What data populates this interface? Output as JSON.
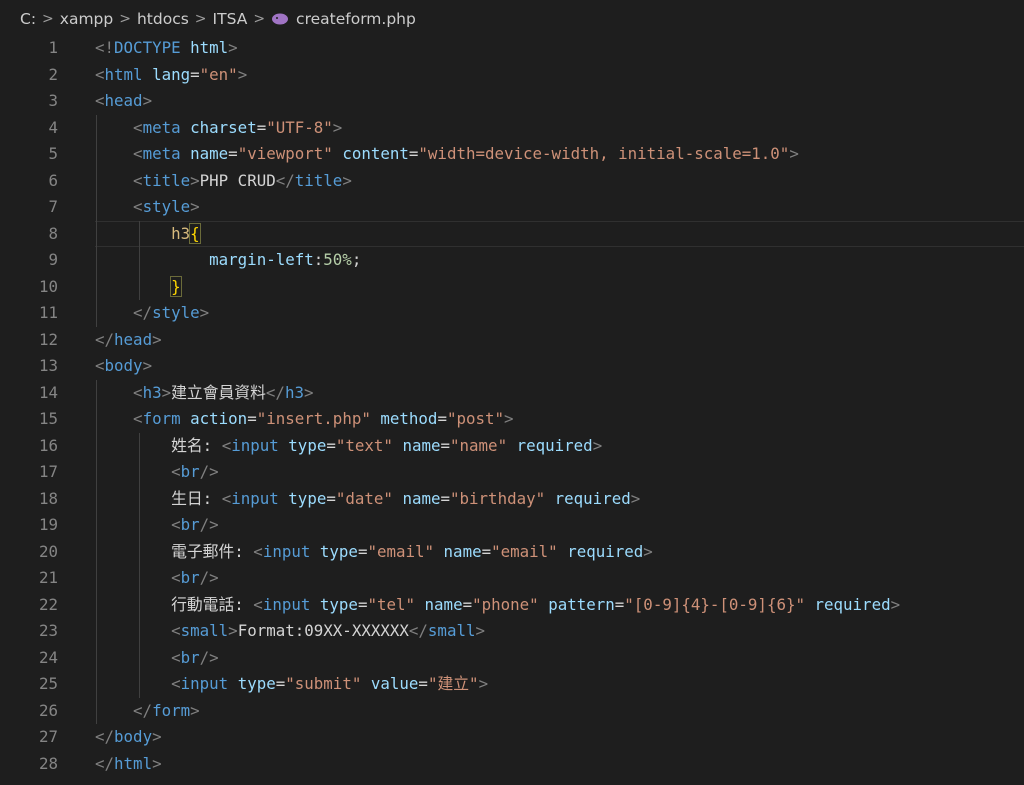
{
  "breadcrumb": {
    "items": [
      "C:",
      "xampp",
      "htdocs",
      "ITSA",
      "createform.php"
    ],
    "separator": ">",
    "file_icon": "php-elephant-icon"
  },
  "editor": {
    "line_numbers": [
      "1",
      "2",
      "3",
      "4",
      "5",
      "6",
      "7",
      "8",
      "9",
      "10",
      "11",
      "12",
      "13",
      "14",
      "15",
      "16",
      "17",
      "18",
      "19",
      "20",
      "21",
      "22",
      "23",
      "24",
      "25",
      "26",
      "27",
      "28"
    ],
    "lines": [
      [
        [
          "t",
          "<!"
        ],
        [
          "tag",
          "DOCTYPE"
        ],
        [
          "tx",
          " "
        ],
        [
          "at",
          "html"
        ],
        [
          "t",
          ">"
        ]
      ],
      [
        [
          "t",
          "<"
        ],
        [
          "tag",
          "html"
        ],
        [
          "tx",
          " "
        ],
        [
          "at",
          "lang"
        ],
        [
          "tx",
          "="
        ],
        [
          "st",
          "\"en\""
        ],
        [
          "t",
          ">"
        ]
      ],
      [
        [
          "t",
          "<"
        ],
        [
          "tag",
          "head"
        ],
        [
          "t",
          ">"
        ]
      ],
      [
        [
          "tx",
          "    "
        ],
        [
          "t",
          "<"
        ],
        [
          "tag",
          "meta"
        ],
        [
          "tx",
          " "
        ],
        [
          "at",
          "charset"
        ],
        [
          "tx",
          "="
        ],
        [
          "st",
          "\"UTF-8\""
        ],
        [
          "t",
          ">"
        ]
      ],
      [
        [
          "tx",
          "    "
        ],
        [
          "t",
          "<"
        ],
        [
          "tag",
          "meta"
        ],
        [
          "tx",
          " "
        ],
        [
          "at",
          "name"
        ],
        [
          "tx",
          "="
        ],
        [
          "st",
          "\"viewport\""
        ],
        [
          "tx",
          " "
        ],
        [
          "at",
          "content"
        ],
        [
          "tx",
          "="
        ],
        [
          "st",
          "\"width=device-width, initial-scale=1.0\""
        ],
        [
          "t",
          ">"
        ]
      ],
      [
        [
          "tx",
          "    "
        ],
        [
          "t",
          "<"
        ],
        [
          "tag",
          "title"
        ],
        [
          "t",
          ">"
        ],
        [
          "tx",
          "PHP CRUD"
        ],
        [
          "t",
          "</"
        ],
        [
          "tag",
          "title"
        ],
        [
          "t",
          ">"
        ]
      ],
      [
        [
          "tx",
          "    "
        ],
        [
          "t",
          "<"
        ],
        [
          "tag",
          "style"
        ],
        [
          "t",
          ">"
        ]
      ],
      [
        [
          "tx",
          "        "
        ],
        [
          "sel",
          "h3"
        ],
        [
          "brace",
          "{"
        ]
      ],
      [
        [
          "tx",
          "            "
        ],
        [
          "at",
          "margin-left"
        ],
        [
          "tx",
          ":"
        ],
        [
          "num",
          "50%"
        ],
        [
          "tx",
          ";"
        ]
      ],
      [
        [
          "tx",
          "        "
        ],
        [
          "brace",
          "}"
        ]
      ],
      [
        [
          "tx",
          "    "
        ],
        [
          "t",
          "</"
        ],
        [
          "tag",
          "style"
        ],
        [
          "t",
          ">"
        ]
      ],
      [
        [
          "t",
          "</"
        ],
        [
          "tag",
          "head"
        ],
        [
          "t",
          ">"
        ]
      ],
      [
        [
          "t",
          "<"
        ],
        [
          "tag",
          "body"
        ],
        [
          "t",
          ">"
        ]
      ],
      [
        [
          "tx",
          "    "
        ],
        [
          "t",
          "<"
        ],
        [
          "tag",
          "h3"
        ],
        [
          "t",
          ">"
        ],
        [
          "tx",
          "建立會員資料"
        ],
        [
          "t",
          "</"
        ],
        [
          "tag",
          "h3"
        ],
        [
          "t",
          ">"
        ]
      ],
      [
        [
          "tx",
          "    "
        ],
        [
          "t",
          "<"
        ],
        [
          "tag",
          "form"
        ],
        [
          "tx",
          " "
        ],
        [
          "at",
          "action"
        ],
        [
          "tx",
          "="
        ],
        [
          "st",
          "\"insert.php\""
        ],
        [
          "tx",
          " "
        ],
        [
          "at",
          "method"
        ],
        [
          "tx",
          "="
        ],
        [
          "st",
          "\"post\""
        ],
        [
          "t",
          ">"
        ]
      ],
      [
        [
          "tx",
          "        姓名: "
        ],
        [
          "t",
          "<"
        ],
        [
          "tag",
          "input"
        ],
        [
          "tx",
          " "
        ],
        [
          "at",
          "type"
        ],
        [
          "tx",
          "="
        ],
        [
          "st",
          "\"text\""
        ],
        [
          "tx",
          " "
        ],
        [
          "at",
          "name"
        ],
        [
          "tx",
          "="
        ],
        [
          "st",
          "\"name\""
        ],
        [
          "tx",
          " "
        ],
        [
          "at",
          "required"
        ],
        [
          "t",
          ">"
        ]
      ],
      [
        [
          "tx",
          "        "
        ],
        [
          "t",
          "<"
        ],
        [
          "tag",
          "br"
        ],
        [
          "t",
          "/>"
        ]
      ],
      [
        [
          "tx",
          "        生日: "
        ],
        [
          "t",
          "<"
        ],
        [
          "tag",
          "input"
        ],
        [
          "tx",
          " "
        ],
        [
          "at",
          "type"
        ],
        [
          "tx",
          "="
        ],
        [
          "st",
          "\"date\""
        ],
        [
          "tx",
          " "
        ],
        [
          "at",
          "name"
        ],
        [
          "tx",
          "="
        ],
        [
          "st",
          "\"birthday\""
        ],
        [
          "tx",
          " "
        ],
        [
          "at",
          "required"
        ],
        [
          "t",
          ">"
        ]
      ],
      [
        [
          "tx",
          "        "
        ],
        [
          "t",
          "<"
        ],
        [
          "tag",
          "br"
        ],
        [
          "t",
          "/>"
        ]
      ],
      [
        [
          "tx",
          "        電子郵件: "
        ],
        [
          "t",
          "<"
        ],
        [
          "tag",
          "input"
        ],
        [
          "tx",
          " "
        ],
        [
          "at",
          "type"
        ],
        [
          "tx",
          "="
        ],
        [
          "st",
          "\"email\""
        ],
        [
          "tx",
          " "
        ],
        [
          "at",
          "name"
        ],
        [
          "tx",
          "="
        ],
        [
          "st",
          "\"email\""
        ],
        [
          "tx",
          " "
        ],
        [
          "at",
          "required"
        ],
        [
          "t",
          ">"
        ]
      ],
      [
        [
          "tx",
          "        "
        ],
        [
          "t",
          "<"
        ],
        [
          "tag",
          "br"
        ],
        [
          "t",
          "/>"
        ]
      ],
      [
        [
          "tx",
          "        行動電話: "
        ],
        [
          "t",
          "<"
        ],
        [
          "tag",
          "input"
        ],
        [
          "tx",
          " "
        ],
        [
          "at",
          "type"
        ],
        [
          "tx",
          "="
        ],
        [
          "st",
          "\"tel\""
        ],
        [
          "tx",
          " "
        ],
        [
          "at",
          "name"
        ],
        [
          "tx",
          "="
        ],
        [
          "st",
          "\"phone\""
        ],
        [
          "tx",
          " "
        ],
        [
          "at",
          "pattern"
        ],
        [
          "tx",
          "="
        ],
        [
          "st",
          "\"[0-9]{4}-[0-9]{6}\""
        ],
        [
          "tx",
          " "
        ],
        [
          "at",
          "required"
        ],
        [
          "t",
          ">"
        ]
      ],
      [
        [
          "tx",
          "        "
        ],
        [
          "t",
          "<"
        ],
        [
          "tag",
          "small"
        ],
        [
          "t",
          ">"
        ],
        [
          "tx",
          "Format:09XX-XXXXXX"
        ],
        [
          "t",
          "</"
        ],
        [
          "tag",
          "small"
        ],
        [
          "t",
          ">"
        ]
      ],
      [
        [
          "tx",
          "        "
        ],
        [
          "t",
          "<"
        ],
        [
          "tag",
          "br"
        ],
        [
          "t",
          "/>"
        ]
      ],
      [
        [
          "tx",
          "        "
        ],
        [
          "t",
          "<"
        ],
        [
          "tag",
          "input"
        ],
        [
          "tx",
          " "
        ],
        [
          "at",
          "type"
        ],
        [
          "tx",
          "="
        ],
        [
          "st",
          "\"submit\""
        ],
        [
          "tx",
          " "
        ],
        [
          "at",
          "value"
        ],
        [
          "tx",
          "="
        ],
        [
          "st",
          "\"建立\""
        ],
        [
          "t",
          ">"
        ]
      ],
      [
        [
          "tx",
          "    "
        ],
        [
          "t",
          "</"
        ],
        [
          "tag",
          "form"
        ],
        [
          "t",
          ">"
        ]
      ],
      [
        [
          "t",
          "</"
        ],
        [
          "tag",
          "body"
        ],
        [
          "t",
          ">"
        ]
      ],
      [
        [
          "t",
          "</"
        ],
        [
          "tag",
          "html"
        ],
        [
          "t",
          ">"
        ]
      ]
    ]
  }
}
